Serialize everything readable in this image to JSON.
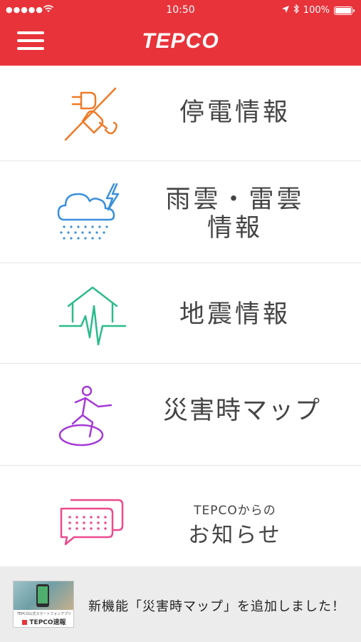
{
  "status_bar": {
    "signal": "●●●●●",
    "time": "10:50",
    "battery": "100%"
  },
  "header": {
    "logo": "TEPCO"
  },
  "menu": {
    "outage": "停電情報",
    "rain_line1": "雨雲・雷雲",
    "rain_line2": "情報",
    "earthquake": "地震情報",
    "disaster_map": "災害時マップ",
    "news_small": "TEPCOからの",
    "news_big": "お知らせ"
  },
  "banner": {
    "text": "新機能「災害時マップ」を追加しました！",
    "thumb_caption": "TEPCO公式スマートフォンアプリ",
    "thumb_brand": "TEPCO速報"
  },
  "colors": {
    "brand_red": "#e8333a",
    "outage_orange": "#f07a28",
    "rain_blue": "#3a8fdc",
    "quake_green": "#2bbb8c",
    "map_purple": "#a53ad6",
    "news_pink": "#ec4a8e"
  }
}
